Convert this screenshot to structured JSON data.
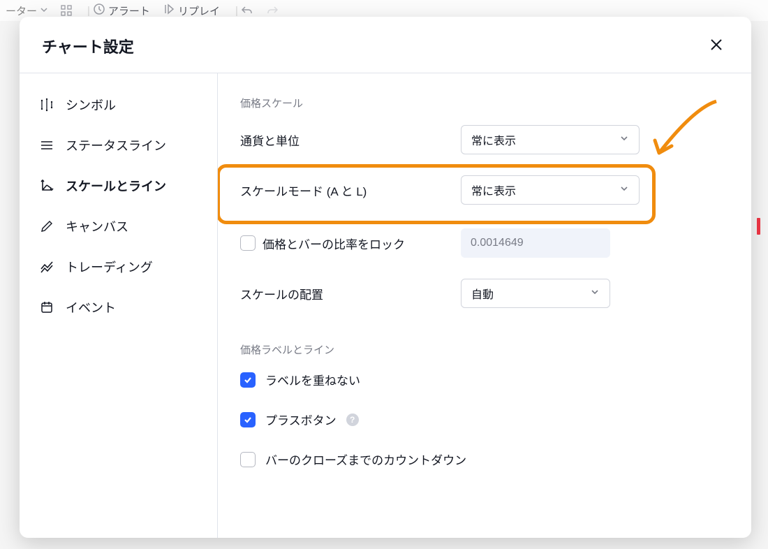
{
  "bg_toolbar": {
    "indicator_partial": "ーター",
    "alert": "アラート",
    "replay": "リプレイ"
  },
  "modal": {
    "title": "チャート設定"
  },
  "sidebar": {
    "items": [
      {
        "label": "シンボル"
      },
      {
        "label": "ステータスライン"
      },
      {
        "label": "スケールとライン"
      },
      {
        "label": "キャンバス"
      },
      {
        "label": "トレーディング"
      },
      {
        "label": "イベント"
      }
    ]
  },
  "content": {
    "section1_label": "価格スケール",
    "row1": {
      "label": "通貨と単位",
      "value": "常に表示"
    },
    "row2": {
      "label": "スケールモード (A と L)",
      "value": "常に表示"
    },
    "row3": {
      "label": "価格とバーの比率をロック",
      "value": "0.0014649"
    },
    "row4": {
      "label": "スケールの配置",
      "value": "自動"
    },
    "section2_label": "価格ラベルとライン",
    "cb1": {
      "label": "ラベルを重ねない"
    },
    "cb2": {
      "label": "プラスボタン"
    },
    "cb3": {
      "label": "バーのクローズまでのカウントダウン"
    }
  }
}
